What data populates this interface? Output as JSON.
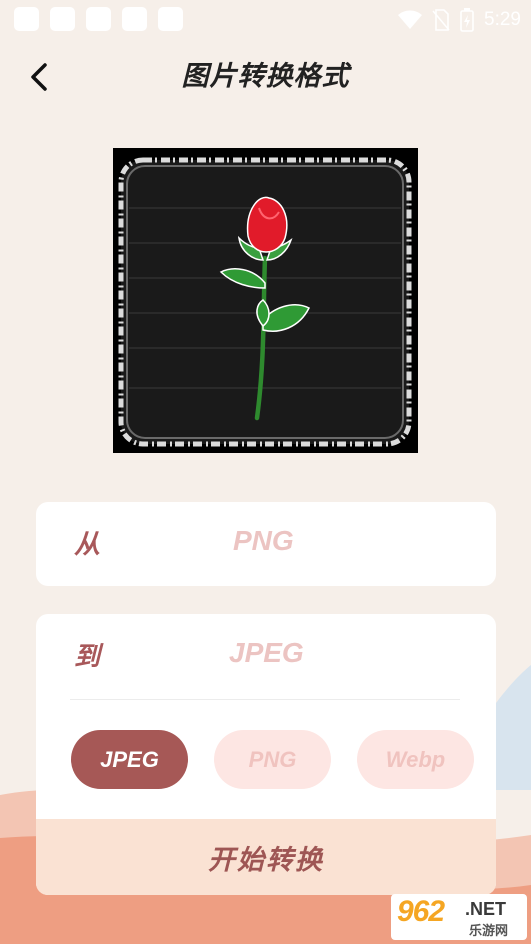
{
  "status_bar": {
    "time": "5:29",
    "icons": [
      "wifi-icon",
      "no-sim-icon",
      "battery-icon"
    ]
  },
  "header": {
    "back_icon": "chevron-left-icon",
    "title": "图片转换格式"
  },
  "from": {
    "label": "从",
    "value": "PNG"
  },
  "to": {
    "label": "到",
    "value": "JPEG"
  },
  "format_options": [
    {
      "label": "JPEG",
      "selected": true
    },
    {
      "label": "PNG",
      "selected": false
    },
    {
      "label": "Webp",
      "selected": false
    }
  ],
  "start_button": {
    "label": "开始转换"
  },
  "watermark": {
    "number": "962",
    "domain": ".NET",
    "cn": "乐游网"
  },
  "colors": {
    "background": "#f6efe9",
    "accent": "#a65856",
    "muted": "#ecc4c2",
    "start_bg": "#fae2d3"
  }
}
